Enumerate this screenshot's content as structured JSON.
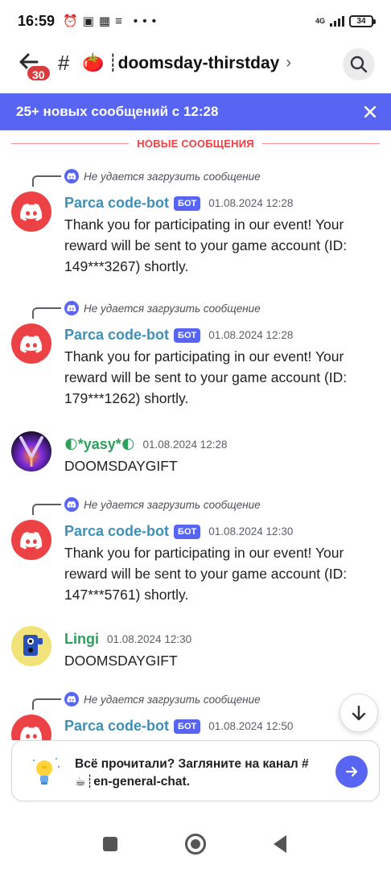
{
  "status_bar": {
    "time": "16:59",
    "network": "4G",
    "battery": "34"
  },
  "header": {
    "back_badge": "30",
    "hash": "#",
    "channel_emoji": "🍅",
    "channel_name": "┊doomsday-thirstday",
    "chevron": "›"
  },
  "banner": {
    "text": "25+ новых сообщений с 12:28"
  },
  "divider": {
    "label": "НОВЫЕ СООБЩЕНИЯ"
  },
  "messages": [
    {
      "reply": "Не удается загрузить сообщение",
      "author": "Parca code-bot",
      "tag": "БОТ",
      "time": "01.08.2024 12:28",
      "body": "Thank you for participating in our event! Your reward will be sent to your game account (ID: 149***3267) shortly."
    },
    {
      "reply": "Не удается загрузить сообщение",
      "author": "Parca code-bot",
      "tag": "БОТ",
      "time": "01.08.2024 12:28",
      "body": "Thank you for participating in our event! Your reward will be sent to your game account (ID: 179***1262) shortly."
    },
    {
      "author_moon_left": "🌓",
      "author": "*yasy*",
      "author_moon_right": "🌓",
      "time": "01.08.2024 12:28",
      "body": "DOOMSDAYGIFT"
    },
    {
      "reply": "Не удается загрузить сообщение",
      "author": "Parca code-bot",
      "tag": "БОТ",
      "time": "01.08.2024 12:30",
      "body": "Thank you for participating in our event! Your reward will be sent to your game account (ID: 147***5761) shortly."
    },
    {
      "author": "Lingi",
      "time": "01.08.2024 12:30",
      "body": "DOOMSDAYGIFT"
    },
    {
      "reply": "Не удается загрузить сообщение",
      "author": "Parca code-bot",
      "tag": "БОТ",
      "time": "01.08.2024 12:50"
    }
  ],
  "card": {
    "line1": "Всё прочитали? Загляните на канал #",
    "line2": "☕┊en-general-chat."
  },
  "colors": {
    "blurple": "#5865f2",
    "bot_avatar": "#ed4245",
    "new_divider": "#f23f43",
    "bot_name": "#3e8fb8",
    "green_name": "#2ea05b"
  }
}
